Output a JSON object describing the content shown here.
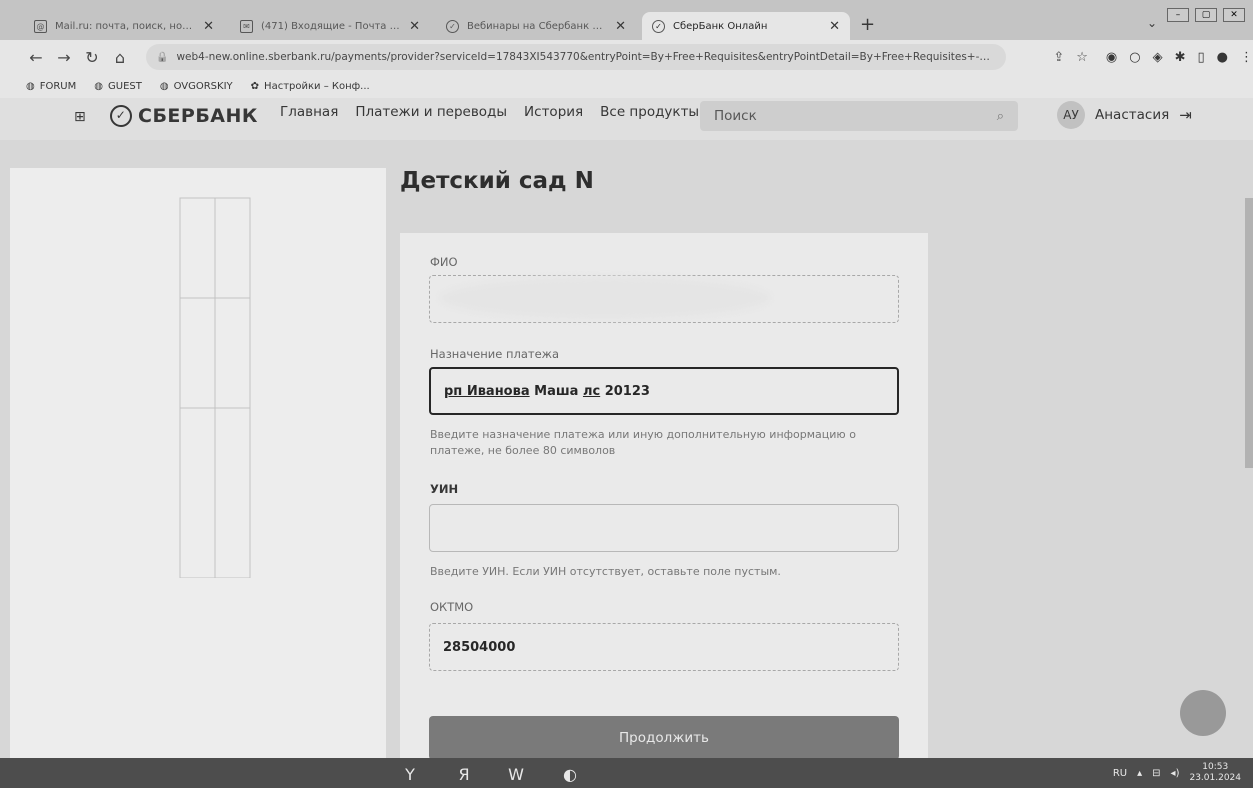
{
  "browser": {
    "tabs": [
      {
        "label": "Mail.ru: почта, поиск, новости",
        "active": false
      },
      {
        "label": "(471) Входящие - Почта Mail.ru",
        "active": false
      },
      {
        "label": "Вебинары на Сбербанк Онлайн",
        "active": false
      },
      {
        "label": "СберБанк Онлайн",
        "active": true
      }
    ],
    "url": "web4-new.online.sberbank.ru/payments/provider?serviceId=17843XI543770&entryPoint=By+Free+Requisites&entryPointDetail=By+Free+Requisites+-+...",
    "bookmarks": [
      "FORUM",
      "GUEST",
      "OVGORSKIY",
      "Настройки – Конф..."
    ]
  },
  "header": {
    "logo": "СБЕРБАНК",
    "nav": [
      "Главная",
      "Платежи и переводы",
      "История",
      "Все продукты"
    ],
    "search_placeholder": "Поиск",
    "avatar_initials": "АУ",
    "user_name": "Анастасия"
  },
  "form": {
    "title": "Детский сад N",
    "fio_label": "ФИО",
    "fio_value": "",
    "purpose_label": "Назначение платежа",
    "purpose_value_part1": "рп Иванова",
    "purpose_value_part2": " Маша ",
    "purpose_value_part3": "лс",
    "purpose_value_part4": " 20123",
    "purpose_hint": "Введите назначение платежа или иную дополнительную информацию о платеже, не более 80 символов",
    "uin_label": "УИН",
    "uin_value": "",
    "uin_hint": "Введите УИН. Если УИН отсутствует, оставьте поле пустым.",
    "oktmo_label": "ОКТМО",
    "oktmo_value": "28504000",
    "continue_label": "Продолжить"
  },
  "taskbar": {
    "lang": "RU",
    "time": "10:53",
    "date": "23.01.2024"
  }
}
